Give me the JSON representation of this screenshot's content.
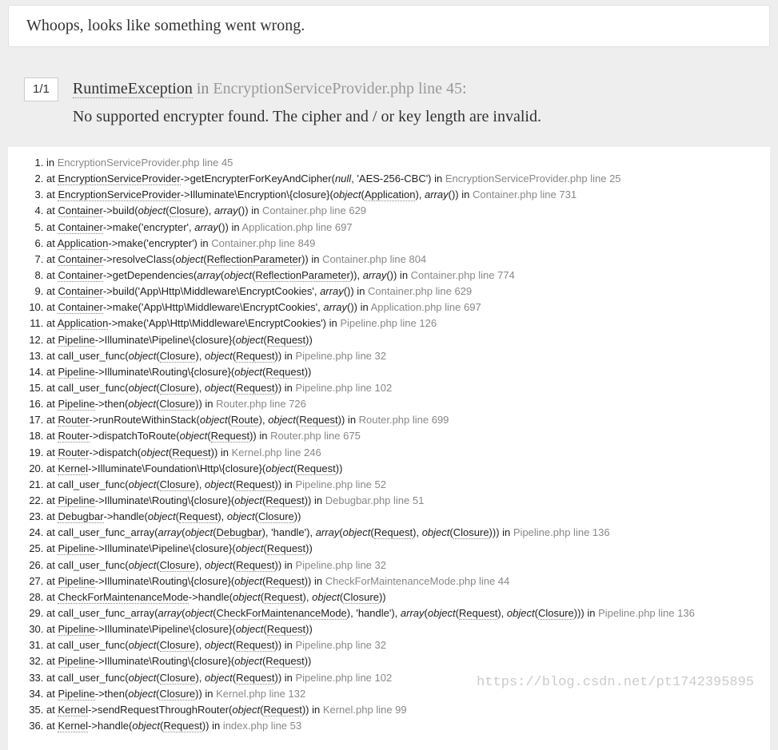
{
  "header": {
    "whoops": "Whoops, looks like something went wrong."
  },
  "exception": {
    "counter": "1/1",
    "class_name": "RuntimeException",
    "in_word": "in",
    "file": "EncryptionServiceProvider.php line 45",
    "colon": ":",
    "message": "No supported encrypter found. The cipher and / or key length are invalid."
  },
  "trace": [
    {
      "html": "in <span class='t-file'>EncryptionServiceProvider.php line 45</span>"
    },
    {
      "html": "at <span class='t-class'>EncryptionServiceProvider</span>->getEncrypterForKeyAndCipher(<span class='t-em'>null</span>, 'AES-256-CBC') in <span class='t-file'>EncryptionServiceProvider.php line 25</span>"
    },
    {
      "html": "at <span class='t-class'>EncryptionServiceProvider</span>->Illuminate\\Encryption\\{closure}(<span class='t-em'>object</span>(<span class='t-abbr'>Application</span>), <span class='t-em'>array</span>()) in <span class='t-file'>Container.php line 731</span>"
    },
    {
      "html": "at <span class='t-class'>Container</span>->build(<span class='t-em'>object</span>(<span class='t-abbr'>Closure</span>), <span class='t-em'>array</span>()) in <span class='t-file'>Container.php line 629</span>"
    },
    {
      "html": "at <span class='t-class'>Container</span>->make('encrypter', <span class='t-em'>array</span>()) in <span class='t-file'>Application.php line 697</span>"
    },
    {
      "html": "at <span class='t-class'>Application</span>->make('encrypter') in <span class='t-file'>Container.php line 849</span>"
    },
    {
      "html": "at <span class='t-class'>Container</span>->resolveClass(<span class='t-em'>object</span>(<span class='t-abbr'>ReflectionParameter</span>)) in <span class='t-file'>Container.php line 804</span>"
    },
    {
      "html": "at <span class='t-class'>Container</span>->getDependencies(<span class='t-em'>array</span>(<span class='t-em'>object</span>(<span class='t-abbr'>ReflectionParameter</span>)), <span class='t-em'>array</span>()) in <span class='t-file'>Container.php line 774</span>"
    },
    {
      "html": "at <span class='t-class'>Container</span>->build('App\\Http\\Middleware\\EncryptCookies', <span class='t-em'>array</span>()) in <span class='t-file'>Container.php line 629</span>"
    },
    {
      "html": "at <span class='t-class'>Container</span>->make('App\\Http\\Middleware\\EncryptCookies', <span class='t-em'>array</span>()) in <span class='t-file'>Application.php line 697</span>"
    },
    {
      "html": "at <span class='t-class'>Application</span>->make('App\\Http\\Middleware\\EncryptCookies') in <span class='t-file'>Pipeline.php line 126</span>"
    },
    {
      "html": "at <span class='t-class'>Pipeline</span>->Illuminate\\Pipeline\\{closure}(<span class='t-em'>object</span>(<span class='t-abbr'>Request</span>))"
    },
    {
      "html": "at call_user_func(<span class='t-em'>object</span>(<span class='t-abbr'>Closure</span>), <span class='t-em'>object</span>(<span class='t-abbr'>Request</span>)) in <span class='t-file'>Pipeline.php line 32</span>"
    },
    {
      "html": "at <span class='t-class'>Pipeline</span>->Illuminate\\Routing\\{closure}(<span class='t-em'>object</span>(<span class='t-abbr'>Request</span>))"
    },
    {
      "html": "at call_user_func(<span class='t-em'>object</span>(<span class='t-abbr'>Closure</span>), <span class='t-em'>object</span>(<span class='t-abbr'>Request</span>)) in <span class='t-file'>Pipeline.php line 102</span>"
    },
    {
      "html": "at <span class='t-class'>Pipeline</span>->then(<span class='t-em'>object</span>(<span class='t-abbr'>Closure</span>)) in <span class='t-file'>Router.php line 726</span>"
    },
    {
      "html": "at <span class='t-class'>Router</span>->runRouteWithinStack(<span class='t-em'>object</span>(<span class='t-abbr'>Route</span>), <span class='t-em'>object</span>(<span class='t-abbr'>Request</span>)) in <span class='t-file'>Router.php line 699</span>"
    },
    {
      "html": "at <span class='t-class'>Router</span>->dispatchToRoute(<span class='t-em'>object</span>(<span class='t-abbr'>Request</span>)) in <span class='t-file'>Router.php line 675</span>"
    },
    {
      "html": "at <span class='t-class'>Router</span>->dispatch(<span class='t-em'>object</span>(<span class='t-abbr'>Request</span>)) in <span class='t-file'>Kernel.php line 246</span>"
    },
    {
      "html": "at <span class='t-class'>Kernel</span>->Illuminate\\Foundation\\Http\\{closure}(<span class='t-em'>object</span>(<span class='t-abbr'>Request</span>))"
    },
    {
      "html": "at call_user_func(<span class='t-em'>object</span>(<span class='t-abbr'>Closure</span>), <span class='t-em'>object</span>(<span class='t-abbr'>Request</span>)) in <span class='t-file'>Pipeline.php line 52</span>"
    },
    {
      "html": "at <span class='t-class'>Pipeline</span>->Illuminate\\Routing\\{closure}(<span class='t-em'>object</span>(<span class='t-abbr'>Request</span>)) in <span class='t-file'>Debugbar.php line 51</span>"
    },
    {
      "html": "at <span class='t-class'>Debugbar</span>->handle(<span class='t-em'>object</span>(<span class='t-abbr'>Request</span>), <span class='t-em'>object</span>(<span class='t-abbr'>Closure</span>))"
    },
    {
      "html": "at call_user_func_array(<span class='t-em'>array</span>(<span class='t-em'>object</span>(<span class='t-abbr'>Debugbar</span>), 'handle'), <span class='t-em'>array</span>(<span class='t-em'>object</span>(<span class='t-abbr'>Request</span>), <span class='t-em'>object</span>(<span class='t-abbr'>Closure</span>))) in <span class='t-file'>Pipeline.php line 136</span>"
    },
    {
      "html": "at <span class='t-class'>Pipeline</span>->Illuminate\\Pipeline\\{closure}(<span class='t-em'>object</span>(<span class='t-abbr'>Request</span>))"
    },
    {
      "html": "at call_user_func(<span class='t-em'>object</span>(<span class='t-abbr'>Closure</span>), <span class='t-em'>object</span>(<span class='t-abbr'>Request</span>)) in <span class='t-file'>Pipeline.php line 32</span>"
    },
    {
      "html": "at <span class='t-class'>Pipeline</span>->Illuminate\\Routing\\{closure}(<span class='t-em'>object</span>(<span class='t-abbr'>Request</span>)) in <span class='t-file'>CheckForMaintenanceMode.php line 44</span>"
    },
    {
      "html": "at <span class='t-class'>CheckForMaintenanceMode</span>->handle(<span class='t-em'>object</span>(<span class='t-abbr'>Request</span>), <span class='t-em'>object</span>(<span class='t-abbr'>Closure</span>))"
    },
    {
      "html": "at call_user_func_array(<span class='t-em'>array</span>(<span class='t-em'>object</span>(<span class='t-abbr'>CheckForMaintenanceMode</span>), 'handle'), <span class='t-em'>array</span>(<span class='t-em'>object</span>(<span class='t-abbr'>Request</span>), <span class='t-em'>object</span>(<span class='t-abbr'>Closure</span>))) in <span class='t-file'>Pipeline.php line 136</span>"
    },
    {
      "html": "at <span class='t-class'>Pipeline</span>->Illuminate\\Pipeline\\{closure}(<span class='t-em'>object</span>(<span class='t-abbr'>Request</span>))"
    },
    {
      "html": "at call_user_func(<span class='t-em'>object</span>(<span class='t-abbr'>Closure</span>), <span class='t-em'>object</span>(<span class='t-abbr'>Request</span>)) in <span class='t-file'>Pipeline.php line 32</span>"
    },
    {
      "html": "at <span class='t-class'>Pipeline</span>->Illuminate\\Routing\\{closure}(<span class='t-em'>object</span>(<span class='t-abbr'>Request</span>))"
    },
    {
      "html": "at call_user_func(<span class='t-em'>object</span>(<span class='t-abbr'>Closure</span>), <span class='t-em'>object</span>(<span class='t-abbr'>Request</span>)) in <span class='t-file'>Pipeline.php line 102</span>"
    },
    {
      "html": "at <span class='t-class'>Pipeline</span>->then(<span class='t-em'>object</span>(<span class='t-abbr'>Closure</span>)) in <span class='t-file'>Kernel.php line 132</span>"
    },
    {
      "html": "at <span class='t-class'>Kernel</span>->sendRequestThroughRouter(<span class='t-em'>object</span>(<span class='t-abbr'>Request</span>)) in <span class='t-file'>Kernel.php line 99</span>"
    },
    {
      "html": "at <span class='t-class'>Kernel</span>->handle(<span class='t-em'>object</span>(<span class='t-abbr'>Request</span>)) in <span class='t-file'>index.php line 53</span>"
    }
  ],
  "watermark": "https://blog.csdn.net/pt1742395895"
}
